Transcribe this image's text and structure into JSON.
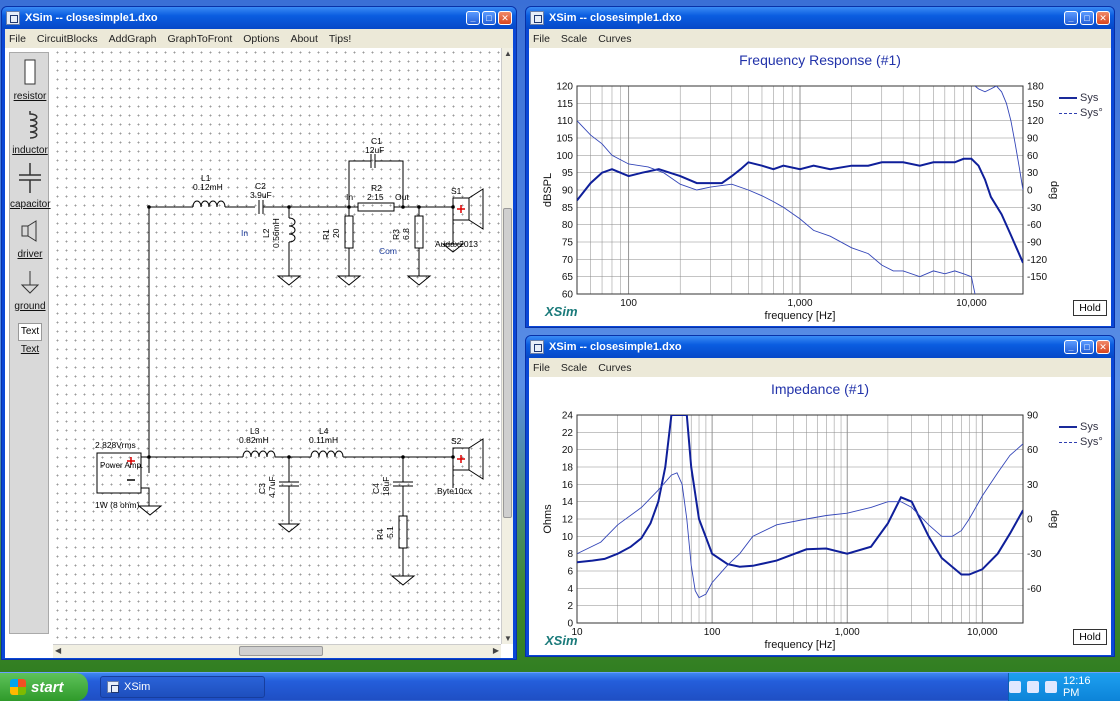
{
  "circuit_window": {
    "title": "XSim -- closesimple1.dxo",
    "menu": [
      "File",
      "CircuitBlocks",
      "AddGraph",
      "GraphToFront",
      "Options",
      "About",
      "Tips!"
    ],
    "palette": [
      "resistor",
      "inductor",
      "capacitor",
      "driver",
      "ground",
      "Text"
    ],
    "palette_text_box": "Text",
    "components": {
      "l1_name": "L1",
      "l1_val": "0.12mH",
      "c2_name": "C2",
      "c2_val": "3.9uF",
      "c1_name": "C1",
      "c1_val": "12uF",
      "r2_name": "R2",
      "r2_val": "2.15",
      "in_label": "In",
      "out_label": "Out",
      "in2_label": "In",
      "l2_name": "L2",
      "l2_val": "0.56mH",
      "r1_name": "R1",
      "r1_val": "20",
      "com_label": "Com",
      "r3_name": "R3",
      "r3_val": "6.8",
      "s1_name": "S1",
      "s1_model": "Audax2013",
      "amp_volts": "2.828Vrms",
      "amp_label": "Power Amp.",
      "amp_power": "1W (8 ohm)",
      "l3_name": "L3",
      "l3_val": "0.82mH",
      "l4_name": "L4",
      "l4_val": "0.11mH",
      "c3_name": "C3",
      "c3_val": "4.7uF",
      "c4_name": "C4",
      "c4_val": "18uF",
      "r4_name": "R4",
      "r4_val": "5.1",
      "s2_name": "S2",
      "s2_model": "Byte10cx"
    }
  },
  "freq_window": {
    "title": "XSim -- closesimple1.dxo",
    "menu": [
      "File",
      "Scale",
      "Curves"
    ],
    "hold": "Hold",
    "logo": "XSim",
    "chart_data": {
      "type": "line",
      "title": "Frequency Response (#1)",
      "xlabel": "frequency [Hz]",
      "ylabel": "dBSPL",
      "y2label": "deg",
      "xscale": "log",
      "xlim": [
        50,
        20000
      ],
      "ylim": [
        60,
        120
      ],
      "y2lim": [
        -180,
        180
      ],
      "xticks": [
        "100",
        "1,000",
        "10,000"
      ],
      "yticks": [
        "120",
        "115",
        "110",
        "105",
        "100",
        "95",
        "90",
        "85",
        "80",
        "75",
        "70",
        "65",
        "60"
      ],
      "y2ticks": [
        "180",
        "150",
        "120",
        "90",
        "60",
        "30",
        "0",
        "-30",
        "-60",
        "-90",
        "-120",
        "-150"
      ],
      "legend": [
        "Sys",
        "Sys°"
      ],
      "grid": true,
      "series": [
        {
          "name": "Sys",
          "axis": "y",
          "x": [
            50,
            60,
            70,
            80,
            100,
            120,
            150,
            200,
            250,
            300,
            350,
            400,
            450,
            500,
            600,
            700,
            800,
            1000,
            1200,
            1500,
            2000,
            2500,
            3000,
            4000,
            5000,
            6000,
            7000,
            8000,
            9000,
            10000,
            11000,
            12000,
            13000,
            15000,
            17000,
            20000
          ],
          "y": [
            87,
            92,
            95,
            96,
            94,
            95,
            96,
            94,
            92,
            92,
            92,
            94,
            96,
            98,
            97,
            96,
            97,
            96,
            97,
            96,
            97,
            97,
            98,
            98,
            97,
            98,
            98,
            98,
            99,
            99,
            97,
            93,
            88,
            83,
            77,
            69
          ]
        },
        {
          "name": "Sys°",
          "axis": "y2",
          "x": [
            50,
            60,
            70,
            80,
            100,
            130,
            160,
            200,
            250,
            300,
            400,
            500,
            600,
            700,
            800,
            1000,
            1200,
            1500,
            2000,
            2500,
            3000,
            3500,
            4000,
            5000,
            6000,
            7000,
            8000,
            9000,
            10000,
            10500
          ],
          "y": [
            120,
            95,
            80,
            60,
            45,
            40,
            30,
            10,
            0,
            5,
            10,
            0,
            -10,
            -20,
            -30,
            -50,
            -70,
            -80,
            -100,
            -110,
            -130,
            -140,
            -140,
            -150,
            -140,
            -145,
            -140,
            -145,
            -150,
            -180
          ]
        },
        {
          "name": "Sys°",
          "axis": "y2",
          "x": [
            10500,
            11000,
            12000,
            13000,
            14000,
            15000,
            16000,
            17000,
            18000,
            19000,
            20000
          ],
          "y": [
            180,
            175,
            170,
            175,
            180,
            170,
            150,
            120,
            80,
            40,
            0
          ]
        }
      ]
    }
  },
  "imp_window": {
    "title": "XSim -- closesimple1.dxo",
    "menu": [
      "File",
      "Scale",
      "Curves"
    ],
    "hold": "Hold",
    "logo": "XSim",
    "chart_data": {
      "type": "line",
      "title": "Impedance (#1)",
      "xlabel": "frequency [Hz]",
      "ylabel": "Ohms",
      "y2label": "deg",
      "xscale": "log",
      "xlim": [
        10,
        20000
      ],
      "ylim": [
        0,
        24
      ],
      "y2lim": [
        -90,
        90
      ],
      "xticks": [
        "10",
        "100",
        "1,000",
        "10,000"
      ],
      "yticks": [
        "24",
        "22",
        "20",
        "18",
        "16",
        "14",
        "12",
        "10",
        "8",
        "6",
        "4",
        "2",
        "0"
      ],
      "y2ticks": [
        "90",
        "60",
        "30",
        "0",
        "-30",
        "-60"
      ],
      "legend": [
        "Sys",
        "Sys°"
      ],
      "grid": true,
      "series": [
        {
          "name": "Sys",
          "axis": "y",
          "x": [
            10,
            13,
            16,
            20,
            25,
            30,
            35,
            40,
            45,
            50,
            55,
            60,
            65,
            70,
            80,
            100,
            130,
            160,
            200,
            300,
            500,
            700,
            1000,
            1500,
            2000,
            2500,
            3000,
            4000,
            5000,
            7000,
            8000,
            10000,
            13000,
            16000,
            20000
          ],
          "y": [
            7,
            7.2,
            7.4,
            8,
            8.8,
            9.8,
            11.5,
            14,
            18,
            24,
            24,
            24,
            24,
            18,
            12,
            8,
            6.8,
            6.5,
            6.6,
            7.2,
            8.5,
            8.6,
            8,
            8.8,
            11.5,
            14.5,
            14,
            10,
            7.5,
            5.6,
            5.6,
            6.2,
            8,
            10.3,
            13
          ]
        },
        {
          "name": "Sys°",
          "axis": "y2",
          "x": [
            10,
            15,
            20,
            30,
            40,
            50,
            55,
            60,
            65,
            70,
            75,
            80,
            90,
            100,
            130,
            160,
            200,
            300,
            500,
            700,
            1000,
            1500,
            2000,
            2500,
            3000,
            4000,
            5000,
            6000,
            7000,
            8000,
            10000,
            13000,
            16000,
            20000
          ],
          "y": [
            -30,
            -20,
            -5,
            10,
            25,
            38,
            40,
            30,
            0,
            -40,
            -62,
            -68,
            -65,
            -55,
            -40,
            -30,
            -15,
            -5,
            0,
            3,
            5,
            10,
            15,
            15,
            10,
            -5,
            -15,
            -15,
            -10,
            0,
            20,
            40,
            55,
            65
          ]
        }
      ]
    }
  },
  "taskbar": {
    "start": "start",
    "task": "XSim",
    "time": "12:16 PM"
  }
}
